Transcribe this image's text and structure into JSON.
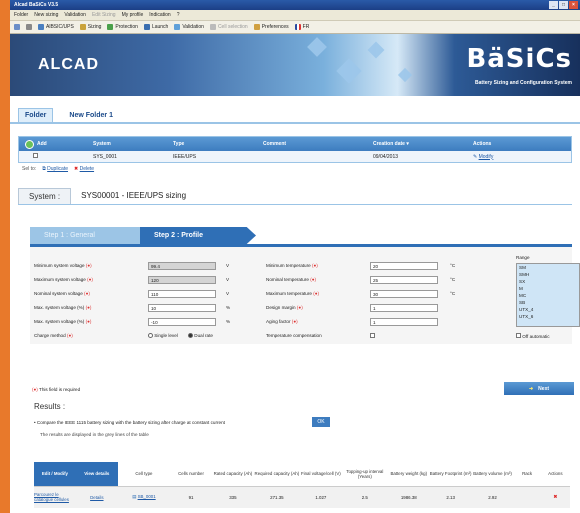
{
  "window": {
    "title": "Alcad BaSiCs V3.5"
  },
  "menu": [
    "Folder",
    "New sizing",
    "Validation",
    "Edit Sizing",
    "My profile",
    "Indication",
    "?"
  ],
  "toolbar": [
    {
      "label": "AlBSIC/UPS"
    },
    {
      "label": "Sizing"
    },
    {
      "label": "Protection"
    },
    {
      "label": "Launch"
    },
    {
      "label": "Validation"
    },
    {
      "label": "Cell selection"
    },
    {
      "label": "Preferences"
    },
    {
      "label": "FR"
    }
  ],
  "banner": {
    "brand": "ALCAD",
    "product": "BäSiCs",
    "subtitle": "Battery Sizing and Configuration System"
  },
  "folders": {
    "tabs": [
      "Folder",
      "New Folder 1"
    ]
  },
  "grid": {
    "headers": [
      "Add",
      "System",
      "Type",
      "Comment",
      "Creation date",
      "Actions"
    ],
    "rows": [
      {
        "system": "SYS_0001",
        "type": "IEEE/UPS",
        "comment": "",
        "date": "09/04/2013",
        "action": "Modify"
      }
    ],
    "footer": {
      "prefix": "Sel to:",
      "duplicate": "Duplicate",
      "delete": "Delete"
    }
  },
  "system": {
    "tab": "System :",
    "name": "SYS00001 - IEEE/UPS sizing"
  },
  "steps": [
    "Step 1 : General",
    "Step 2 : Profile"
  ],
  "form": {
    "left": [
      {
        "label": "Minimum system voltage",
        "value": "99.4",
        "unit": "V",
        "disabled": true
      },
      {
        "label": "Maximum system voltage",
        "value": "120",
        "unit": "V",
        "disabled": true
      },
      {
        "label": "Nominal system voltage",
        "value": "110",
        "unit": "V",
        "disabled": false
      },
      {
        "label": "Max. system voltage (%)",
        "value": "10",
        "unit": "%",
        "disabled": false
      },
      {
        "label": "Max. system voltage (%)",
        "value": "-10",
        "unit": "%",
        "disabled": false
      },
      {
        "label": "Charge method",
        "value": "",
        "unit": "",
        "disabled": false
      }
    ],
    "charge": {
      "single": "Single level",
      "dual": "Dual rate"
    },
    "right": [
      {
        "label": "Minimum temperature",
        "value": "20",
        "unit": "°C"
      },
      {
        "label": "Nominal temperature",
        "value": "25",
        "unit": "°C"
      },
      {
        "label": "Maximum temperature",
        "value": "30",
        "unit": "°C"
      },
      {
        "label": "Design margin",
        "value": "1",
        "unit": ""
      },
      {
        "label": "Aging factor",
        "value": "1",
        "unit": ""
      },
      {
        "label": "Temperature compensation",
        "value": "",
        "unit": ""
      }
    ],
    "range_label": "Range",
    "range_items": [
      "SM",
      "SMH",
      "SX",
      "M",
      "MC",
      "SB",
      "UTX_4",
      "UTX_6"
    ],
    "off_automatic": "Off automatic"
  },
  "required_note": "This field is required",
  "next_label": "Next",
  "results": {
    "title": "Results :",
    "text": "Compare the IEEE 1115 battery sizing with the battery sizing after charge at constant current",
    "ok": "OK",
    "text2": "The results are displayed in the grey lines of the table",
    "headers": [
      "Edit / Modify",
      "View details",
      "Cell type",
      "Cells number",
      "Rated capacity (Ah)",
      "Required capacity (Ah)",
      "Final voltage/cell (V)",
      "Topping-up interval (Years)",
      "Battery weight (kg)",
      "Battery Footprint (m²)",
      "Battery volume (m³)",
      "Rack",
      "Actions"
    ],
    "rows": [
      {
        "edit": "Parcourez le catalogue cellules",
        "view": "Details",
        "cell": "SB_0001",
        "cells": "91",
        "rated": "335",
        "required": "271.35",
        "final": "1.027",
        "topping": "2.5",
        "weight": "1986.38",
        "footprint": "2.13",
        "volume": "2.92",
        "rack": ""
      }
    ]
  },
  "colors": {
    "accent": "#2f6fb6",
    "frame": "#e8792b",
    "required": "#dd3333"
  }
}
